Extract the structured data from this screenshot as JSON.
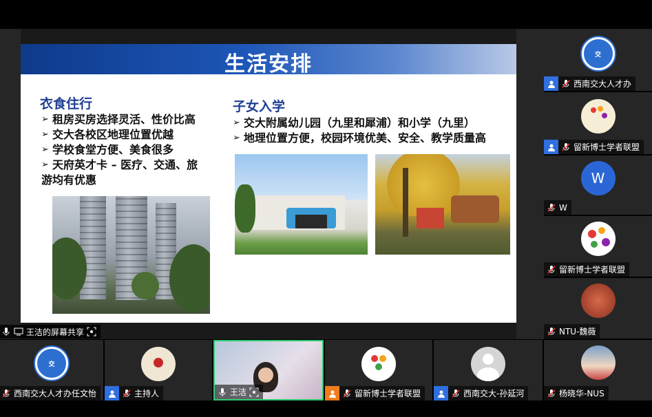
{
  "slide": {
    "title": "生活安排",
    "left": {
      "heading": "衣食住行",
      "bullets": [
        "租房买房选择灵活、性价比高",
        "交大各校区地理位置优越",
        "学校食堂方便、美食很多",
        "天府英才卡 – 医疗、交通、旅"
      ],
      "continuation": "游均有优惠"
    },
    "right": {
      "heading": "子女入学",
      "bullets": [
        "交大附属幼儿园（九里和犀浦）和小学（九里）",
        "地理位置方便，校园环境优美、安全、教学质量高"
      ]
    }
  },
  "share_label": "王洁的屏幕共享",
  "sidebar": [
    {
      "name": "西南交大人才办"
    },
    {
      "name": "留新博士学者联盟"
    },
    {
      "name": "W",
      "avatar_text": "W"
    },
    {
      "name": "留新博士学者联盟"
    },
    {
      "name": "NTU-魏薇"
    }
  ],
  "bottom": [
    {
      "name": "西南交大人才办任文怡"
    },
    {
      "name": "主持人"
    },
    {
      "name": "王洁"
    },
    {
      "name": "留新博士学者联盟"
    },
    {
      "name": "西南交大-孙延河"
    },
    {
      "name": "杨晓华-NUS"
    }
  ],
  "colors": {
    "accent": "#2f6fe0",
    "active_border": "#2ecc71",
    "heading": "#1f3f95"
  }
}
